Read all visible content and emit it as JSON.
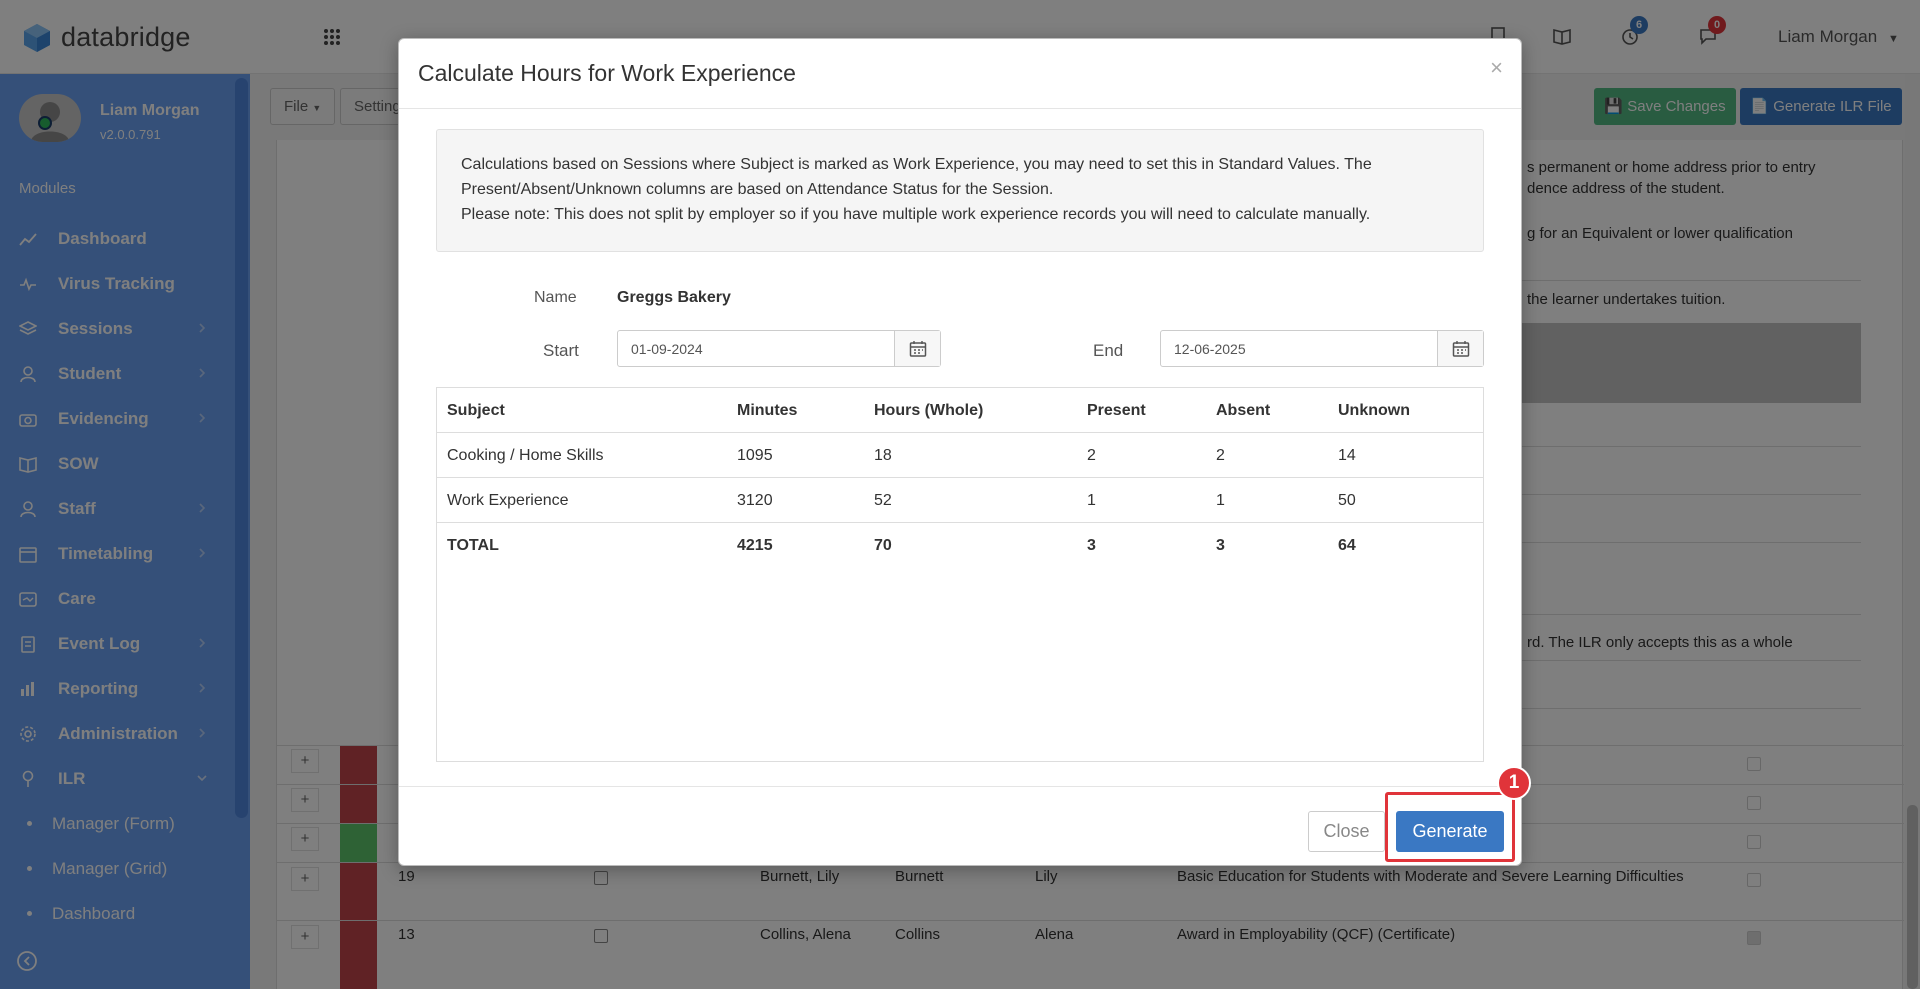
{
  "app": {
    "brand": "databridge",
    "header_user": "Liam Morgan",
    "badges": {
      "timer": "6",
      "chat": "0"
    },
    "colors": {
      "sidebar": "#6aa0f2",
      "primary": "#3a78c3",
      "success": "#52b883",
      "danger": "#e0343a"
    }
  },
  "sidebar": {
    "user_name": "Liam Morgan",
    "version": "v2.0.0.791",
    "section": "Modules",
    "items": [
      {
        "label": "Dashboard",
        "icon": "chart-line-icon",
        "has_children": false
      },
      {
        "label": "Virus Tracking",
        "icon": "heartbeat-icon",
        "has_children": false
      },
      {
        "label": "Sessions",
        "icon": "layers-icon",
        "has_children": true
      },
      {
        "label": "Student",
        "icon": "user-icon",
        "has_children": true
      },
      {
        "label": "Evidencing",
        "icon": "camera-icon",
        "has_children": true
      },
      {
        "label": "SOW",
        "icon": "book-icon",
        "has_children": false
      },
      {
        "label": "Staff",
        "icon": "user-icon",
        "has_children": true
      },
      {
        "label": "Timetabling",
        "icon": "calendar-icon",
        "has_children": true
      },
      {
        "label": "Care",
        "icon": "care-icon",
        "has_children": false
      },
      {
        "label": "Event Log",
        "icon": "clipboard-icon",
        "has_children": true
      },
      {
        "label": "Reporting",
        "icon": "bar-chart-icon",
        "has_children": true
      },
      {
        "label": "Administration",
        "icon": "gear-icon",
        "has_children": true
      },
      {
        "label": "ILR",
        "icon": "pin-icon",
        "has_children": true
      }
    ],
    "sub_items": [
      {
        "label": "Manager (Form)"
      },
      {
        "label": "Manager (Grid)"
      },
      {
        "label": "Dashboard"
      }
    ]
  },
  "toolbar": {
    "file_label": "File",
    "settings_label": "Setting",
    "save_label": "Save Changes",
    "generate_ilr_label": "Generate ILR File"
  },
  "background": {
    "snippets": [
      "s permanent or home address prior to entry",
      "dence address of the student.",
      "g for an Equivalent or lower qualification",
      "the learner undertakes tuition.",
      "rd. The ILR only accepts this as a whole"
    ],
    "rows": [
      {
        "id": "19",
        "full": "Burnett, Lily",
        "last": "Burnett",
        "first": "Lily",
        "course": "Basic Education for Students with Moderate and Severe Learning Difficulties"
      },
      {
        "id": "13",
        "full": "Collins, Alena",
        "last": "Collins",
        "first": "Alena",
        "course": "Award in Employability (QCF) (Certificate)"
      }
    ]
  },
  "modal": {
    "title": "Calculate Hours for Work Experience",
    "info_lines": [
      "Calculations based on Sessions where Subject is marked as Work Experience, you may need to set this in Standard Values. The",
      "Present/Absent/Unknown columns are based on Attendance Status for the Session.",
      "Please note: This does not split by employer so if you have multiple work experience records you will need to calculate manually."
    ],
    "name_label": "Name",
    "name_value": "Greggs Bakery",
    "start_label": "Start",
    "start_value": "01-09-2024",
    "end_label": "End",
    "end_value": "12-06-2025",
    "columns": [
      "Subject",
      "Minutes",
      "Hours (Whole)",
      "Present",
      "Absent",
      "Unknown"
    ],
    "rows": [
      {
        "subject": "Cooking / Home Skills",
        "minutes": "1095",
        "hours": "18",
        "present": "2",
        "absent": "2",
        "unknown": "14"
      },
      {
        "subject": "Work Experience",
        "minutes": "3120",
        "hours": "52",
        "present": "1",
        "absent": "1",
        "unknown": "50"
      }
    ],
    "total": {
      "subject": "TOTAL",
      "minutes": "4215",
      "hours": "70",
      "present": "3",
      "absent": "3",
      "unknown": "64"
    },
    "close_label": "Close",
    "generate_label": "Generate",
    "step_number": "1"
  }
}
